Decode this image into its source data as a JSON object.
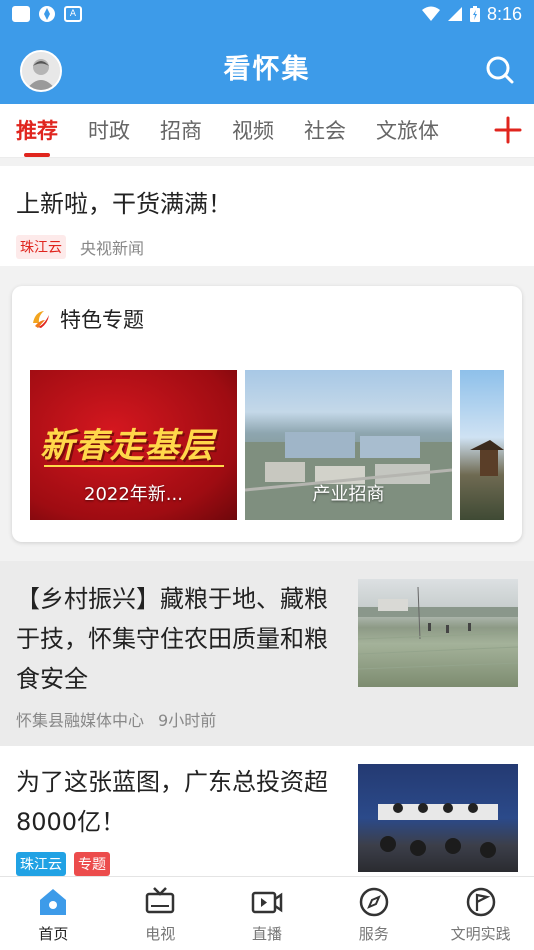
{
  "status_bar": {
    "time": "8:16",
    "left_icons": [
      "square-icon",
      "wheel-icon",
      "a-icon"
    ],
    "right_icons": [
      "wifi-icon",
      "signal-icon",
      "battery-icon"
    ]
  },
  "header": {
    "title": "看怀集",
    "avatar_icon": "user-avatar",
    "search_icon": "search-icon",
    "color": "#3d9be9"
  },
  "tabs": [
    "推荐",
    "时政",
    "招商",
    "视频",
    "社会",
    "文旅体"
  ],
  "tabs_active_index": 0,
  "add_tab_icon": "plus-icon",
  "news_top": {
    "title": "上新啦，干货满满！",
    "tag": "珠江云",
    "source": "央视新闻"
  },
  "topic_card": {
    "title": "特色专题",
    "items": [
      {
        "banner_text": "新春走基层",
        "caption": "2022年新..."
      },
      {
        "caption": "产业招商"
      }
    ]
  },
  "news_items": [
    {
      "title": "【乡村振兴】藏粮于地、藏粮于技，怀集守住农田质量和粮食安全",
      "source": "怀集县融媒体中心",
      "time": "9小时前"
    },
    {
      "title": "为了这张蓝图，广东总投资超8000亿！",
      "tags": [
        "珠江云",
        "专题"
      ]
    }
  ],
  "bottom_nav": [
    {
      "label": "首页",
      "icon": "home-icon",
      "active": true
    },
    {
      "label": "电视",
      "icon": "tv-icon"
    },
    {
      "label": "直播",
      "icon": "live-video-icon"
    },
    {
      "label": "服务",
      "icon": "compass-icon"
    },
    {
      "label": "文明实践",
      "icon": "flag-circle-icon"
    }
  ],
  "accent_colors": {
    "brand_blue": "#3d9be9",
    "active_red": "#e0251e"
  }
}
